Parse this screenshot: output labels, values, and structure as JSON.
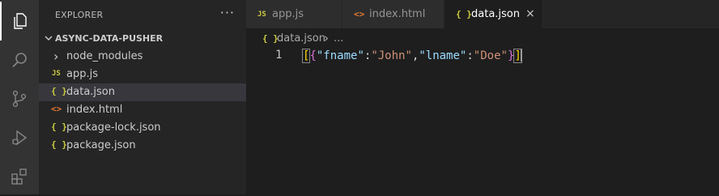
{
  "activity_bar": {
    "icons": [
      "explorer-icon",
      "search-icon",
      "source-control-icon",
      "run-debug-icon",
      "extensions-icon"
    ]
  },
  "explorer": {
    "title": "EXPLORER",
    "more": "···",
    "folder": "ASYNC-DATA-PUSHER",
    "items": [
      {
        "icon": "›",
        "name": "node_modules",
        "type": "folder"
      },
      {
        "icon": "JS",
        "name": "app.js",
        "type": "js"
      },
      {
        "icon": "{ }",
        "name": "data.json",
        "type": "json",
        "selected": true
      },
      {
        "icon": "<>",
        "name": "index.html",
        "type": "html"
      },
      {
        "icon": "{ }",
        "name": "package-lock.json",
        "type": "json"
      },
      {
        "icon": "{ }",
        "name": "package.json",
        "type": "json"
      }
    ]
  },
  "tabs": [
    {
      "icon": "JS",
      "label": "app.js"
    },
    {
      "icon": "<>",
      "label": "index.html"
    },
    {
      "icon": "{ }",
      "label": "data.json",
      "active": true,
      "close": "×"
    }
  ],
  "breadcrumb": {
    "icon": "{ }",
    "file": "data.json",
    "sep": "›",
    "more": "..."
  },
  "code": {
    "line_number": "1",
    "tokens": {
      "open_bracket": "[",
      "open_brace": "{",
      "key1": "\"fname\"",
      "colon": ":",
      "val1": "\"John\"",
      "comma": ",",
      "key2": "\"lname\"",
      "val2": "\"Doe\"",
      "close_brace": "}",
      "close_bracket": "]"
    }
  },
  "colors": {
    "js": "#cbcb41",
    "json": "#cbcb41",
    "html": "#e37933",
    "accent": "#ffffff"
  }
}
